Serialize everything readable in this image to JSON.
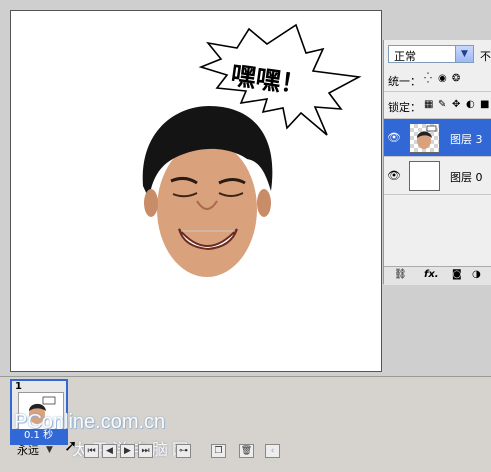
{
  "canvas": {
    "speech_bubble_text": "嘿嘿！"
  },
  "layers_panel": {
    "blend_mode": "正常",
    "opacity_label": "不",
    "unify_label": "统一：",
    "lock_label": "锁定：",
    "layers": [
      {
        "name": "图层 3",
        "selected": true
      },
      {
        "name": "图层 0",
        "selected": false
      }
    ],
    "bottom_fx_label": "fx."
  },
  "animation_palette": {
    "frame_number": "1",
    "frame_delay": "0.1 秒",
    "loop_option": "永远",
    "watermark": "PConline.com.cn",
    "watermark_cn": "太平洋电脑网"
  },
  "icons": [
    "chevron-down-icon",
    "eye-icon",
    "link-icon",
    "mask-icon",
    "adjustment-icon",
    "lock-transparency-icon",
    "lock-brush-icon",
    "lock-move-icon",
    "lock-all-icon",
    "first-frame-icon",
    "prev-frame-icon",
    "play-icon",
    "next-frame-icon",
    "tween-icon",
    "new-frame-icon",
    "trash-icon",
    "cursor-icon"
  ]
}
